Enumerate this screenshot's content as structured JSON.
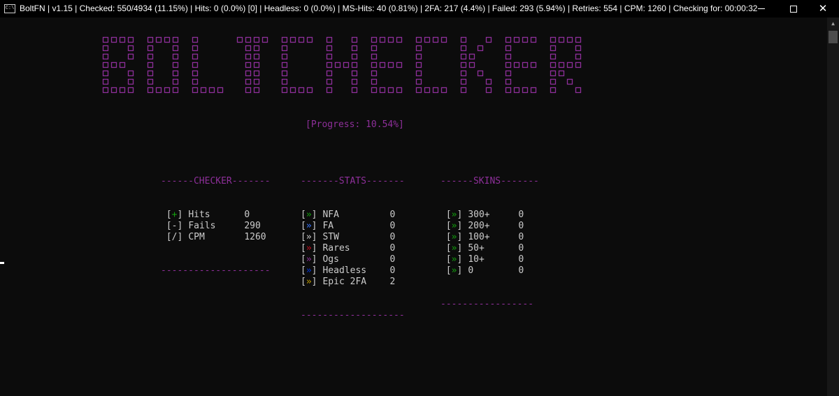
{
  "window": {
    "icon_text": "C:\\",
    "title": "BoltFN | v1.15 | Checked: 550/4934 (11.15%) | Hits: 0 (0.0%) [0] | Headless: 0 (0.0%) | MS-Hits: 40 (0.81%) | 2FA: 217 (4.4%) | Failed: 293 (5.94%) | Retries: 554 | CPM: 1260 | Checking for: 00:00:32"
  },
  "banner": {
    "text": "BOLTCHECKER",
    "color": "#8e2f9a"
  },
  "progress": {
    "text": "[Progress: 10.54%]"
  },
  "checker": {
    "header": "------CHECKER-------",
    "footer": "--------------------",
    "rows": [
      {
        "open": "[",
        "sym": "+",
        "close": "]",
        "label": "Hits",
        "value": "0"
      },
      {
        "open": "[",
        "sym": "-",
        "close": "]",
        "label": "Fails",
        "value": "290"
      },
      {
        "open": "[",
        "sym": "/",
        "close": "]",
        "label": "CPM",
        "value": "1260"
      }
    ]
  },
  "stats": {
    "header": "-------STATS-------",
    "footer": "-------------------",
    "rows": [
      {
        "open": "[",
        "sym": "»",
        "close": "]",
        "label": "NFA",
        "value": "0",
        "color": "#13a10e"
      },
      {
        "open": "[",
        "sym": "»",
        "close": "]",
        "label": "FA",
        "value": "0",
        "color": "#3b78ff"
      },
      {
        "open": "[",
        "sym": "»",
        "close": "]",
        "label": "STW",
        "value": "0",
        "color": "#cccccc"
      },
      {
        "open": "[",
        "sym": "»",
        "close": "]",
        "label": "Rares",
        "value": "0",
        "color": "#c50f1f"
      },
      {
        "open": "[",
        "sym": "»",
        "close": "]",
        "label": "Ogs",
        "value": "0",
        "color": "#8e2f9a"
      },
      {
        "open": "[",
        "sym": "»",
        "close": "]",
        "label": "Headless",
        "value": "0",
        "color": "#0037da"
      },
      {
        "open": "[",
        "sym": "»",
        "close": "]",
        "label": "Epic 2FA",
        "value": "2",
        "color": "#c19c00"
      }
    ]
  },
  "skins": {
    "header": "------SKINS-------",
    "footer": "-----------------",
    "rows": [
      {
        "open": "[",
        "sym": "»",
        "close": "]",
        "label": "300+",
        "value": "0",
        "color": "#13a10e"
      },
      {
        "open": "[",
        "sym": "»",
        "close": "]",
        "label": "200+",
        "value": "0",
        "color": "#13a10e"
      },
      {
        "open": "[",
        "sym": "»",
        "close": "]",
        "label": "100+",
        "value": "0",
        "color": "#13a10e"
      },
      {
        "open": "[",
        "sym": "»",
        "close": "]",
        "label": "50+",
        "value": "0",
        "color": "#13a10e"
      },
      {
        "open": "[",
        "sym": "»",
        "close": "]",
        "label": "10+",
        "value": "0",
        "color": "#13a10e"
      },
      {
        "open": "[",
        "sym": "»",
        "close": "]",
        "label": "0",
        "value": "0",
        "color": "#13a10e"
      }
    ]
  }
}
